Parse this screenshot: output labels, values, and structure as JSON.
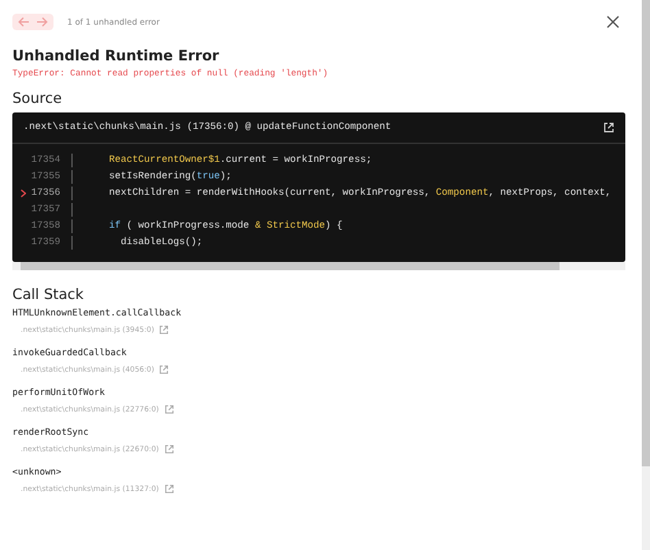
{
  "nav": {
    "prev_disabled": true,
    "next_disabled": true,
    "counter": "1 of 1 unhandled error"
  },
  "title": "Unhandled Runtime Error",
  "message": "TypeError: Cannot read properties of null (reading 'length')",
  "source": {
    "heading": "Source",
    "file": ".next\\static\\chunks\\main.js (17356:0) @ updateFunctionComponent",
    "lines": [
      {
        "number": "17354",
        "active": false,
        "tokens": [
          {
            "kind": "ident",
            "text": "  ReactCurrentOwner$1"
          },
          {
            "kind": "plain",
            "text": ".current = workInProgress;"
          }
        ]
      },
      {
        "number": "17355",
        "active": false,
        "tokens": [
          {
            "kind": "plain",
            "text": "  setIsRendering("
          },
          {
            "kind": "keyword",
            "text": "true"
          },
          {
            "kind": "plain",
            "text": ");"
          }
        ]
      },
      {
        "number": "17356",
        "active": true,
        "tokens": [
          {
            "kind": "plain",
            "text": "  nextChildren = renderWithHooks(current, workInProgress, "
          },
          {
            "kind": "ident",
            "text": "Component"
          },
          {
            "kind": "plain",
            "text": ", nextProps, context,"
          }
        ]
      },
      {
        "number": "17357",
        "active": false
      },
      {
        "number": "17358",
        "active": false,
        "tokens": [
          {
            "kind": "keyword",
            "text": "  if"
          },
          {
            "kind": "plain",
            "text": " ( workInProgress.mode "
          },
          {
            "kind": "ident",
            "text": "& StrictMode"
          },
          {
            "kind": "plain",
            "text": ") {"
          }
        ]
      },
      {
        "number": "17359",
        "active": false,
        "tokens": [
          {
            "kind": "plain",
            "text": "    disableLogs();"
          }
        ]
      }
    ]
  },
  "call_stack": {
    "heading": "Call Stack",
    "frames": [
      {
        "name": "HTMLUnknownElement.callCallback",
        "file": ".next\\static\\chunks\\main.js (3945:0)"
      },
      {
        "name": "invokeGuardedCallback",
        "file": ".next\\static\\chunks\\main.js (4056:0)"
      },
      {
        "name": "performUnitOfWork",
        "file": ".next\\static\\chunks\\main.js (22776:0)"
      },
      {
        "name": "renderRootSync",
        "file": ".next\\static\\chunks\\main.js (22670:0)"
      },
      {
        "name": "<unknown>",
        "file": ".next\\static\\chunks\\main.js (11327:0)"
      }
    ]
  }
}
